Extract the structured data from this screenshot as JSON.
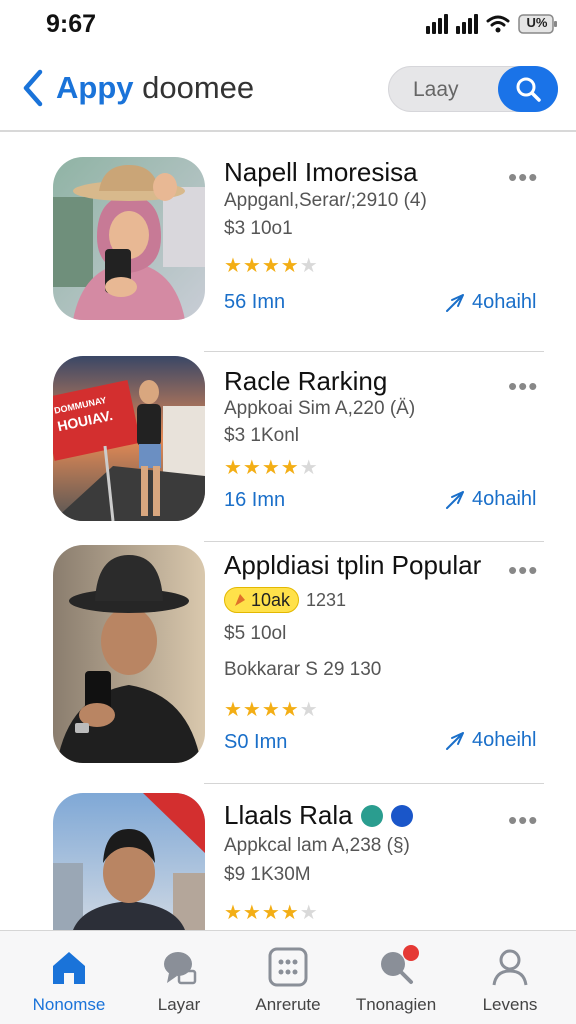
{
  "status": {
    "time": "9:67",
    "battery": "U%"
  },
  "header": {
    "title_accent": "Appy",
    "title_rest": "doomee",
    "search_placeholder": "Laay"
  },
  "apps": [
    {
      "title": "Napell Imoresisa",
      "subtitle": "Appganl,Serar/;2910 (4)",
      "price": "$3 10o1",
      "rating": 3.5,
      "left_meta": "56 Imn",
      "right_meta": "4ohaihl"
    },
    {
      "title": "Racle Rarking",
      "subtitle": "Appkoai Sim A,220 (Ä)",
      "price": "$3 1Konl",
      "rating": 4,
      "sign_text": "DOMMUNAY HOUIAV.",
      "left_meta": "16 Imn",
      "right_meta": "4ohaihl"
    },
    {
      "title": "Appldiasi tplin Popular",
      "badge": "10ak",
      "badge_extra": "1231",
      "price": "$5 10ol",
      "subtitle": "Bokkarar S 29 130",
      "rating": 3.5,
      "left_meta": "S0 Imn",
      "right_meta": "4oheihl"
    },
    {
      "title": "Llaals Rala",
      "subtitle": "Appkcal lam A,238 (§)",
      "price": "$9 1K30M",
      "rating": 4
    }
  ],
  "tabs": [
    {
      "label": "Nonomse",
      "icon": "home-icon",
      "active": true
    },
    {
      "label": "Layar",
      "icon": "chat-icon"
    },
    {
      "label": "Anrerute",
      "icon": "grid-icon"
    },
    {
      "label": "Tnonagien",
      "icon": "search-icon"
    },
    {
      "label": "Levens",
      "icon": "person-icon"
    }
  ],
  "colors": {
    "accent": "#1a73d9",
    "star": "#f3ae15",
    "badge": "#ffe14a"
  }
}
